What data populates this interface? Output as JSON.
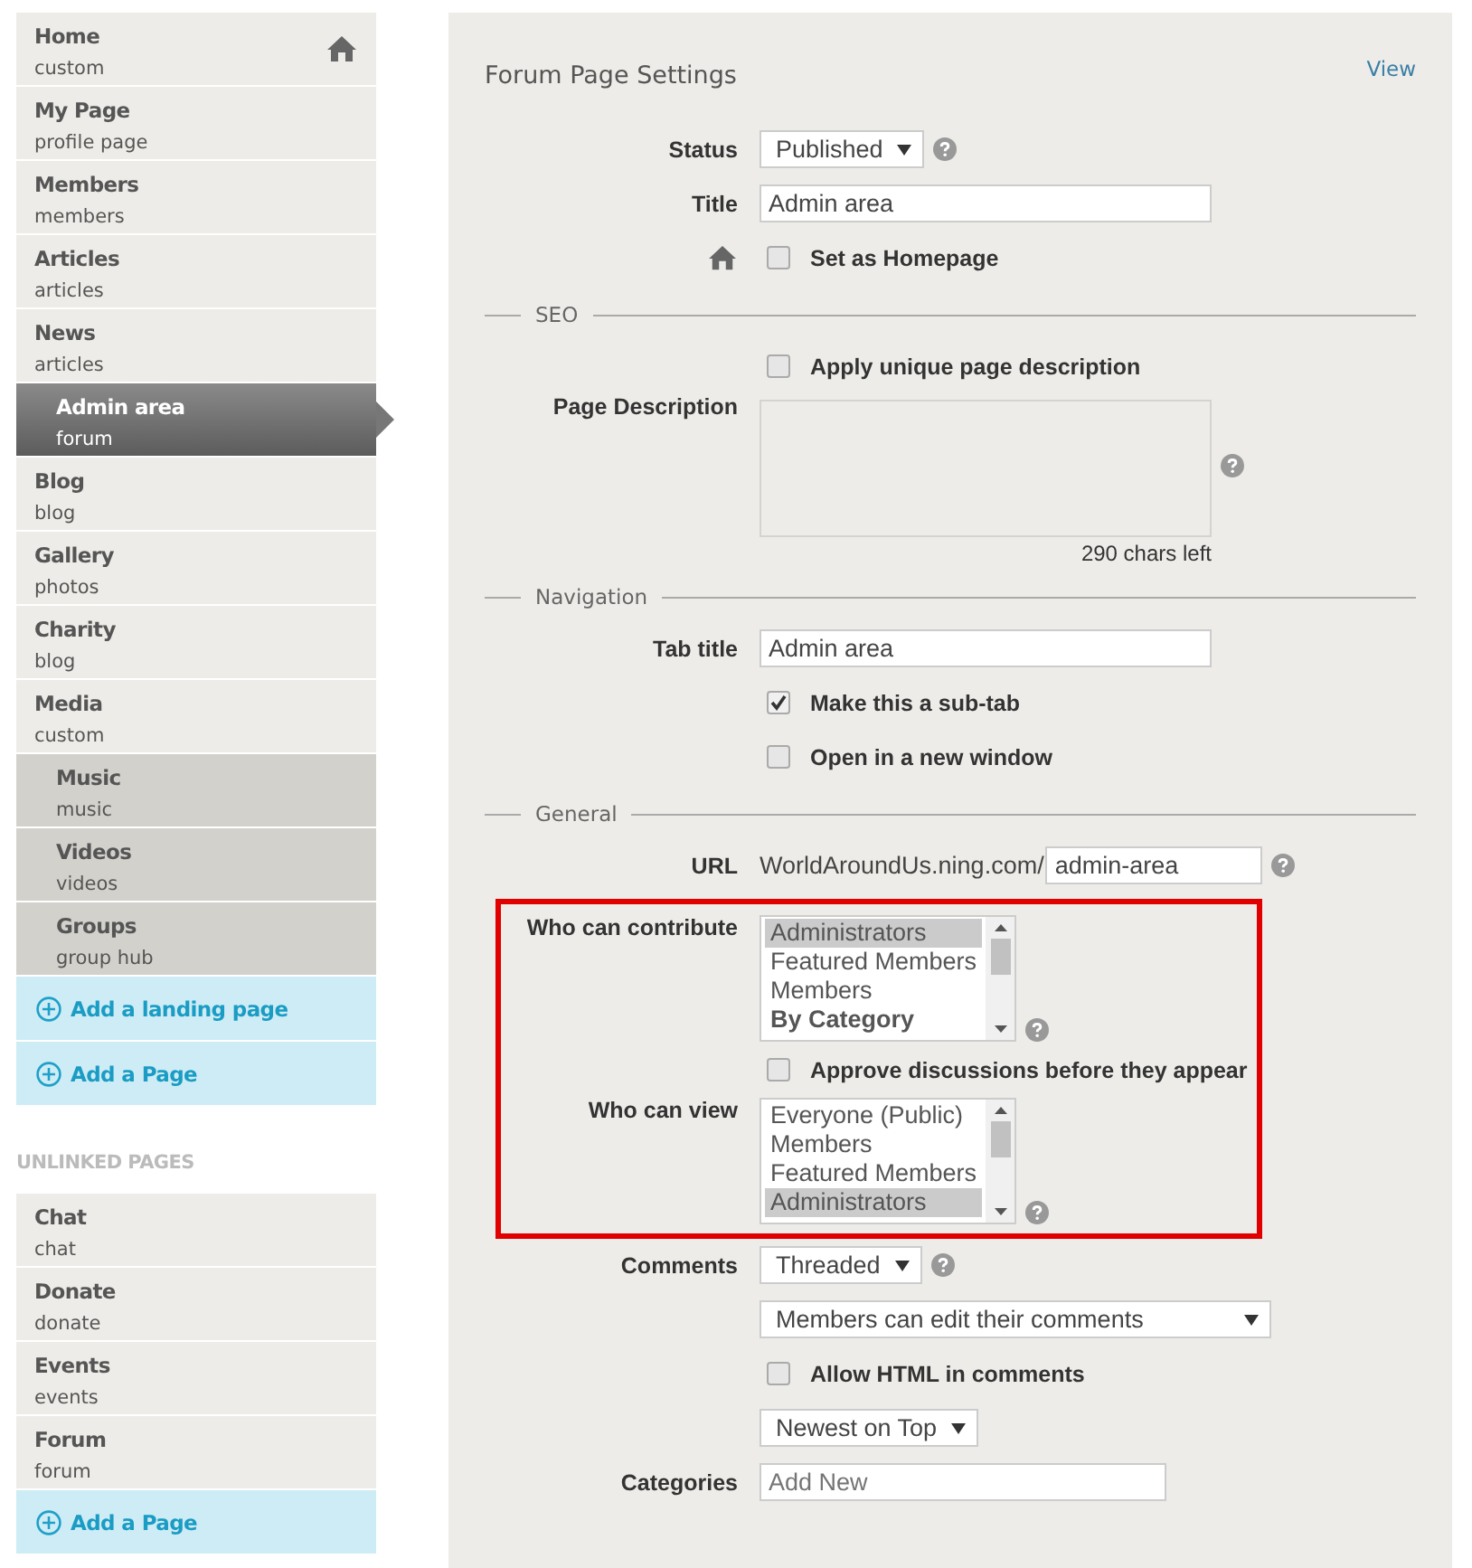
{
  "sidebar": {
    "linked_pages": [
      {
        "name": "Home",
        "type": "custom",
        "kind": "page",
        "homepage": true,
        "selected": false
      },
      {
        "name": "My Page",
        "type": "profile page",
        "kind": "page",
        "homepage": false,
        "selected": false
      },
      {
        "name": "Members",
        "type": "members",
        "kind": "page",
        "homepage": false,
        "selected": false
      },
      {
        "name": "Articles",
        "type": "articles",
        "kind": "page",
        "homepage": false,
        "selected": false
      },
      {
        "name": "News",
        "type": "articles",
        "kind": "page",
        "homepage": false,
        "selected": false
      },
      {
        "name": "Admin area",
        "type": "forum",
        "kind": "subpage",
        "homepage": false,
        "selected": true
      },
      {
        "name": "Blog",
        "type": "blog",
        "kind": "page",
        "homepage": false,
        "selected": false
      },
      {
        "name": "Gallery",
        "type": "photos",
        "kind": "page",
        "homepage": false,
        "selected": false
      },
      {
        "name": "Charity",
        "type": "blog",
        "kind": "page",
        "homepage": false,
        "selected": false
      },
      {
        "name": "Media",
        "type": "custom",
        "kind": "page",
        "homepage": false,
        "selected": false
      },
      {
        "name": "Music",
        "type": "music",
        "kind": "subpage",
        "homepage": false,
        "selected": false
      },
      {
        "name": "Videos",
        "type": "videos",
        "kind": "subpage",
        "homepage": false,
        "selected": false
      },
      {
        "name": "Groups",
        "type": "group hub",
        "kind": "subpage",
        "homepage": false,
        "selected": false
      }
    ],
    "linked_actions": [
      "Add a landing page",
      "Add a Page"
    ],
    "unlinked_heading": "UNLINKED PAGES",
    "unlinked_pages": [
      {
        "name": "Chat",
        "type": "chat",
        "selected": false
      },
      {
        "name": "Donate",
        "type": "donate",
        "selected": false
      },
      {
        "name": "Events",
        "type": "events",
        "selected": false
      },
      {
        "name": "Forum",
        "type": "forum",
        "selected": false
      }
    ],
    "unlinked_actions": [
      "Add a Page"
    ]
  },
  "settings": {
    "title": "Forum Page Settings",
    "view_link": "View",
    "status": {
      "label": "Status",
      "value": "Published"
    },
    "title_field": {
      "label": "Title",
      "value": "Admin area"
    },
    "homepage": {
      "label": "Set as Homepage",
      "checked": false
    },
    "seo": {
      "heading": "SEO",
      "unique_description": {
        "label": "Apply unique page description",
        "checked": false
      },
      "description_label": "Page Description",
      "chars_left": "290 chars left"
    },
    "navigation": {
      "heading": "Navigation",
      "tab_title": {
        "label": "Tab title",
        "value": "Admin area"
      },
      "options": [
        {
          "label": "Make this a sub-tab",
          "checked": true
        },
        {
          "label": "Open in a new window",
          "checked": false
        }
      ]
    },
    "general": {
      "heading": "General",
      "url": {
        "label": "URL",
        "prefix": "WorldAroundUs.ning.com/",
        "value": "admin-area"
      },
      "access": {
        "highlighted": true,
        "contribute": {
          "label": "Who can contribute",
          "options": [
            {
              "text": "Administrators",
              "kind": "option",
              "selected": true
            },
            {
              "text": "Featured Members",
              "kind": "option",
              "selected": false
            },
            {
              "text": "Members",
              "kind": "option",
              "selected": false
            },
            {
              "text": "By Category",
              "kind": "group",
              "selected": false
            }
          ]
        },
        "approve": {
          "label": "Approve discussions before they appear",
          "checked": false
        },
        "view": {
          "label": "Who can view",
          "options": [
            {
              "text": "Everyone (Public)",
              "selected": false
            },
            {
              "text": "Members",
              "selected": false
            },
            {
              "text": "Featured Members",
              "selected": false
            },
            {
              "text": "Administrators",
              "selected": true
            }
          ]
        }
      },
      "comments": {
        "label": "Comments",
        "style": "Threaded",
        "editing": "Members can edit their comments"
      },
      "allow_html": {
        "label": "Allow HTML in comments",
        "checked": false
      },
      "order": "Newest on Top",
      "categories": {
        "label": "Categories",
        "placeholder": "Add New"
      }
    }
  }
}
